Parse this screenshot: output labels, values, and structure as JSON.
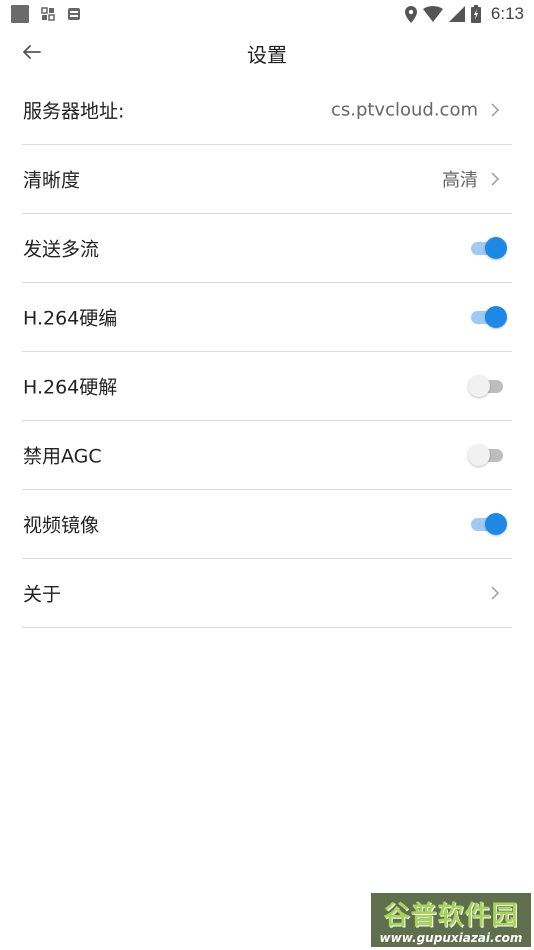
{
  "status_bar": {
    "time": "6:13",
    "icons": [
      "app-square-icon",
      "grid-icon",
      "notification-icon",
      "location-icon",
      "wifi-icon",
      "signal-icon",
      "battery-icon"
    ]
  },
  "app_bar": {
    "title": "设置",
    "back_icon": "back-arrow-icon"
  },
  "settings": {
    "server": {
      "label": "服务器地址:",
      "value": "cs.ptvcloud.com"
    },
    "resolution": {
      "label": "清晰度",
      "value": "高清"
    },
    "multi_stream": {
      "label": "发送多流",
      "enabled": true
    },
    "h264_encode": {
      "label": "H.264硬编",
      "enabled": true
    },
    "h264_decode": {
      "label": "H.264硬解",
      "enabled": false
    },
    "disable_agc": {
      "label": "禁用AGC",
      "enabled": false
    },
    "video_mirror": {
      "label": "视频镜像",
      "enabled": true
    },
    "about": {
      "label": "关于"
    }
  },
  "watermark": {
    "title": "谷普软件园",
    "url": "www.gupuxiazai.com"
  },
  "colors": {
    "accent": "#1e88e5",
    "toggle_on_track": "#9fcaf1",
    "toggle_off_track": "#bdbdbd",
    "divider": "#dcdcdc"
  }
}
